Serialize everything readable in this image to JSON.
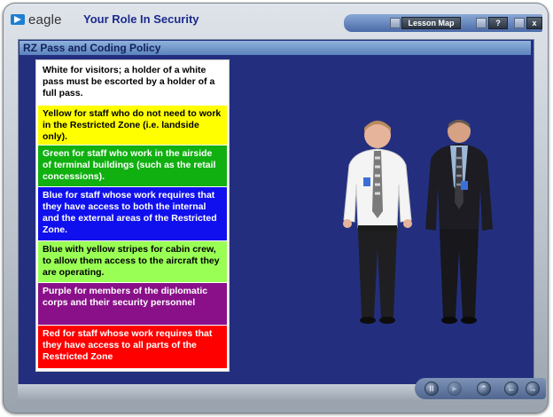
{
  "app": {
    "logo_text": "eagle",
    "title": "Your Role In Security"
  },
  "toolbar": {
    "lesson_map": "Lesson Map",
    "help": "?",
    "close": "x"
  },
  "section": {
    "title": "RZ Pass and Coding Policy"
  },
  "passes": [
    {
      "text": "White for visitors; a holder of a white pass must be escorted by a holder of a full pass.",
      "bg": "#ffffff",
      "fg": "#000000"
    },
    {
      "text": "Yellow for staff who do not need to work in the Restricted Zone (i.e. landside only).",
      "bg": "#ffff00",
      "fg": "#000000"
    },
    {
      "text": "Green for staff who work in the airside of terminal buildings (such as the retail concessions).",
      "bg": "#10b010",
      "fg": "#ffffff"
    },
    {
      "text": "Blue for staff whose work requires that they have access to both the internal and the external areas of the Restricted Zone.",
      "bg": "#1010ee",
      "fg": "#ffffff"
    },
    {
      "text": "Blue with yellow stripes for cabin crew, to allow them access to the aircraft they are operating.",
      "bg": "#99ff55",
      "fg": "#000000"
    },
    {
      "text": "Purple for members of the diplomatic corps and their security personnel",
      "bg": "#8a108a",
      "fg": "#ffffff"
    },
    {
      "text": "Red for staff whose work requires that they have access to all parts of the Restricted Zone",
      "bg": "#ff0000",
      "fg": "#ffffff"
    }
  ],
  "colors": {
    "panel_bg": "#232f7e",
    "title_text": "#1c2b8c"
  },
  "icons": [
    "eagle-logo-icon",
    "minimize-icon",
    "help-icon",
    "close-icon",
    "pause-icon",
    "play-icon",
    "home-icon",
    "back-icon",
    "forward-icon"
  ]
}
